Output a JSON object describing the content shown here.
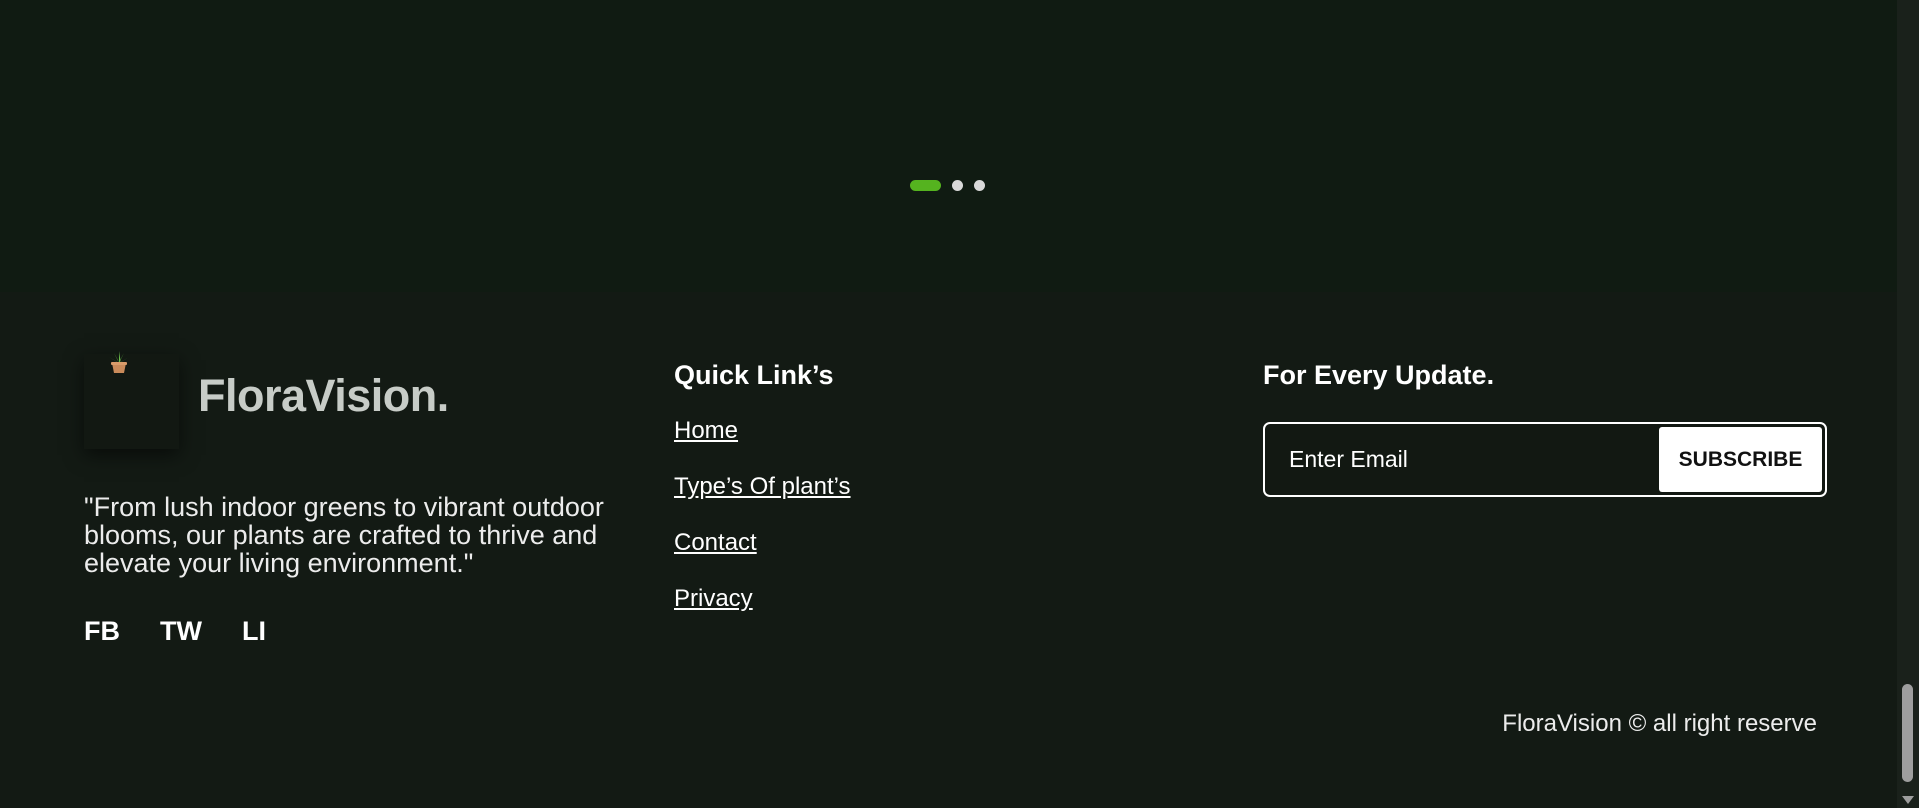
{
  "carousel": {
    "slides": 3,
    "active_index": 0,
    "colors": {
      "active": "#55b31f",
      "inactive": "#d9d9d9"
    }
  },
  "brand": {
    "name": "FloraVision.",
    "logo_icon": "potted-plant-icon",
    "tagline": "\"From lush indoor greens to vibrant outdoor blooms, our plants are crafted to thrive and elevate your living environment.\"",
    "social": [
      "FB",
      "TW",
      "LI"
    ]
  },
  "quick_links": {
    "title": "Quick Link’s",
    "items": [
      "Home",
      "Type’s Of plant’s",
      "Contact",
      "Privacy"
    ]
  },
  "update": {
    "title": "For Every Update.",
    "email_placeholder": "Enter Email",
    "subscribe_label": "SUBSCRIBE"
  },
  "copyright": "FloraVision © all right reserve",
  "theme": {
    "background": "#131a14",
    "hero_background": "#101b12",
    "text": "#ffffff"
  }
}
